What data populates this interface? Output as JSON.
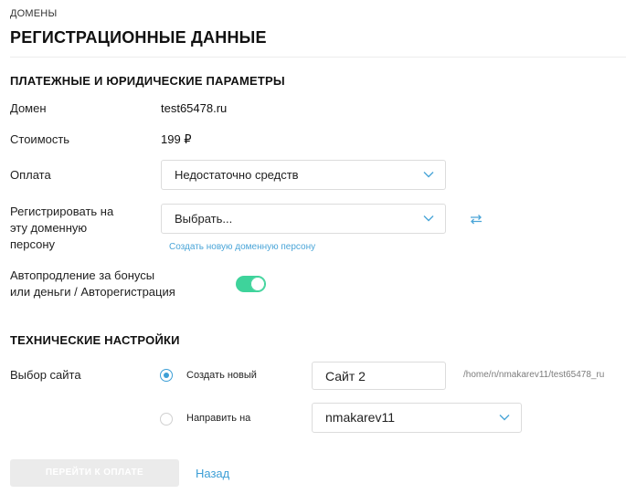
{
  "breadcrumb": "ДОМЕНЫ",
  "page_title": "РЕГИСТРАЦИОННЫЕ ДАННЫЕ",
  "payment_section": {
    "title": "ПЛАТЕЖНЫЕ И ЮРИДИЧЕСКИЕ ПАРАМЕТРЫ",
    "domain_label": "Домен",
    "domain_value": "test65478.ru",
    "cost_label": "Стоимость",
    "cost_value": "199 ₽",
    "payment_label": "Оплата",
    "payment_selected": "Недостаточно средств",
    "person_label_1": "Регистрировать на",
    "person_label_2": "эту доменную",
    "person_label_3": "персону",
    "person_selected": "Выбрать...",
    "create_person_link": "Создать новую доменную персону",
    "autorenew_label_1": "Автопродление за бонусы",
    "autorenew_label_2": "или деньги / Авторегистрация",
    "autorenew_on": true
  },
  "tech_section": {
    "title": "ТЕХНИЧЕСКИЕ НАСТРОЙКИ",
    "site_label": "Выбор сайта",
    "option_create": "Создать новый",
    "site_name_value": "Сайт 2",
    "site_path": "/home/n/nmakarev11/test65478_ru",
    "option_redirect": "Направить на",
    "redirect_selected": "nmakarev11"
  },
  "actions": {
    "pay_button": "ПЕРЕЙТИ К ОПЛАТЕ",
    "back_link": "Назад"
  },
  "colors": {
    "accent": "#3d9fd6",
    "toggle_on": "#3ed39b",
    "disabled_button": "#ebebeb"
  },
  "icons": {
    "select_arrow": "chevron-down-icon",
    "swap": "swap-arrows-icon"
  }
}
